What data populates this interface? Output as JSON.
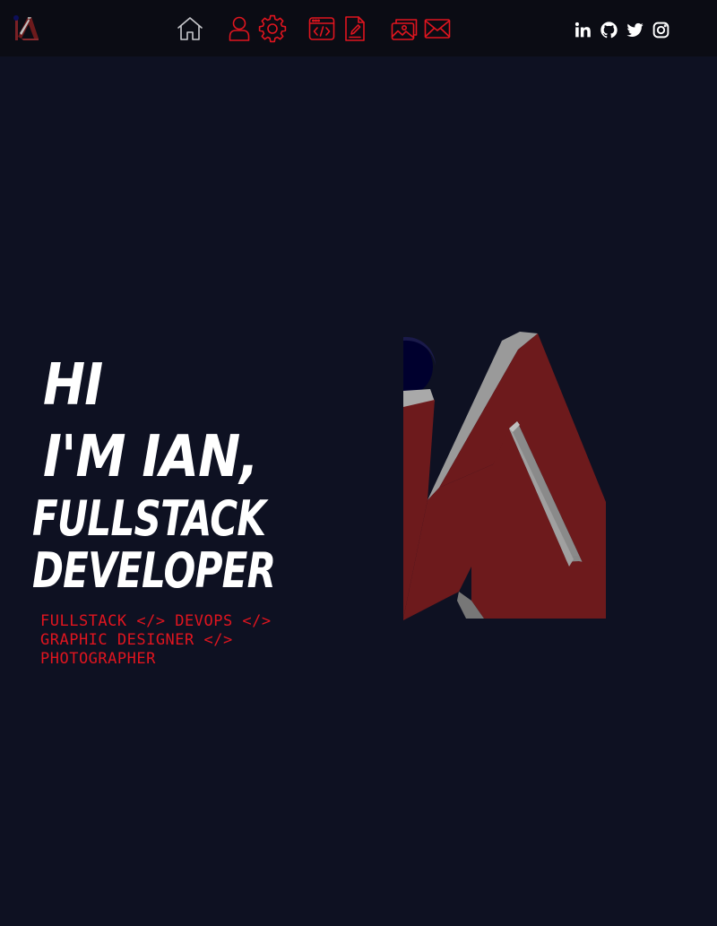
{
  "nav": {
    "brand_icon": "ia-logo-icon",
    "items": [
      {
        "name": "home",
        "icon": "home-icon"
      },
      {
        "name": "about",
        "icon": "user-icon"
      },
      {
        "name": "skills",
        "icon": "gear-icon"
      },
      {
        "name": "projects",
        "icon": "code-window-icon"
      },
      {
        "name": "resume",
        "icon": "document-edit-icon"
      },
      {
        "name": "gallery",
        "icon": "photo-icon"
      },
      {
        "name": "contact",
        "icon": "mail-icon"
      }
    ],
    "social": [
      {
        "name": "linkedin",
        "icon": "linkedin-icon"
      },
      {
        "name": "github",
        "icon": "github-icon"
      },
      {
        "name": "twitter",
        "icon": "twitter-icon"
      },
      {
        "name": "instagram",
        "icon": "instagram-icon"
      }
    ]
  },
  "hero": {
    "line1": "Hi",
    "line2": "I'm Ian,",
    "line3": "Fullstack",
    "line4": "Developer",
    "roles": [
      "FULLSTACK </> DEVOPS </>",
      "GRAPHIC DESIGNER </>",
      "PHOTOGRAPHER"
    ]
  },
  "colors": {
    "background": "#0e1122",
    "topbar": "#0b0c14",
    "accent": "#e0151f",
    "logo_red": "#6d1a1c",
    "logo_navy": "#00002e",
    "text": "#ffffff"
  }
}
